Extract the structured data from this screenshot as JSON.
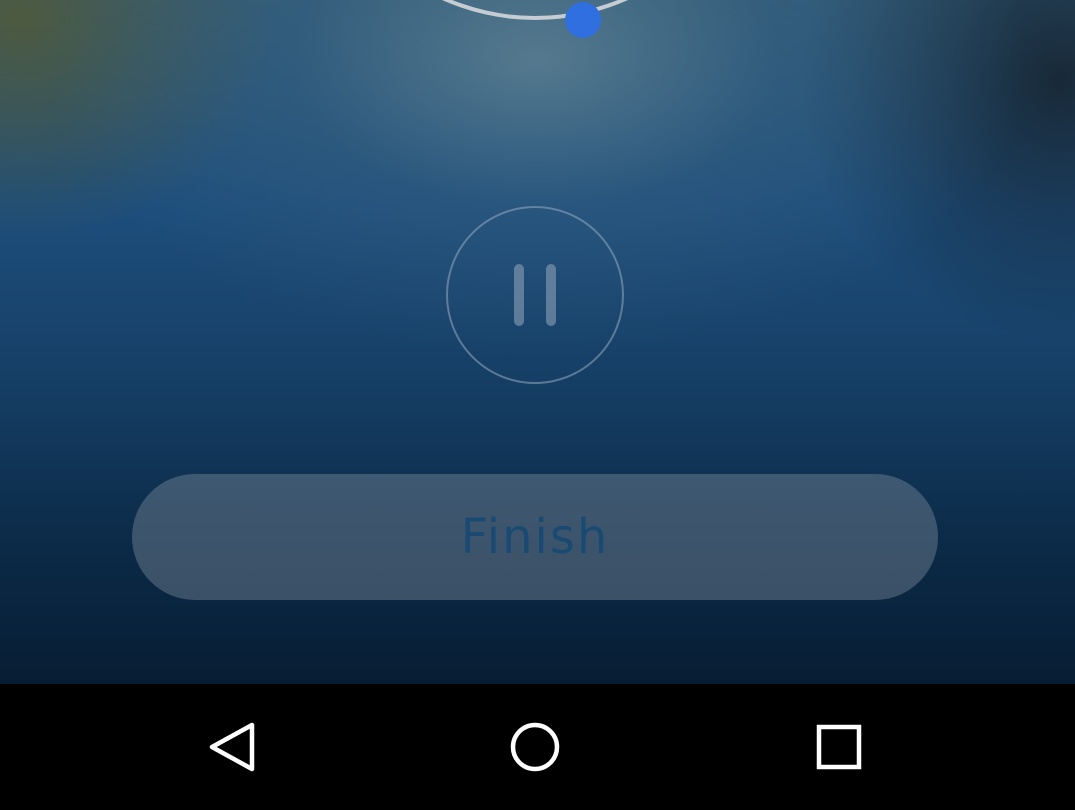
{
  "workout": {
    "finish_label": "Finish",
    "state": "paused"
  },
  "icons": {
    "pause": "pause-icon",
    "back": "back-triangle-icon",
    "home": "home-circle-icon",
    "recents": "recents-square-icon"
  },
  "colors": {
    "accent_knob": "#2f6fe0",
    "finish_text": "#1a4a72",
    "nav_icon": "#ffffff"
  }
}
